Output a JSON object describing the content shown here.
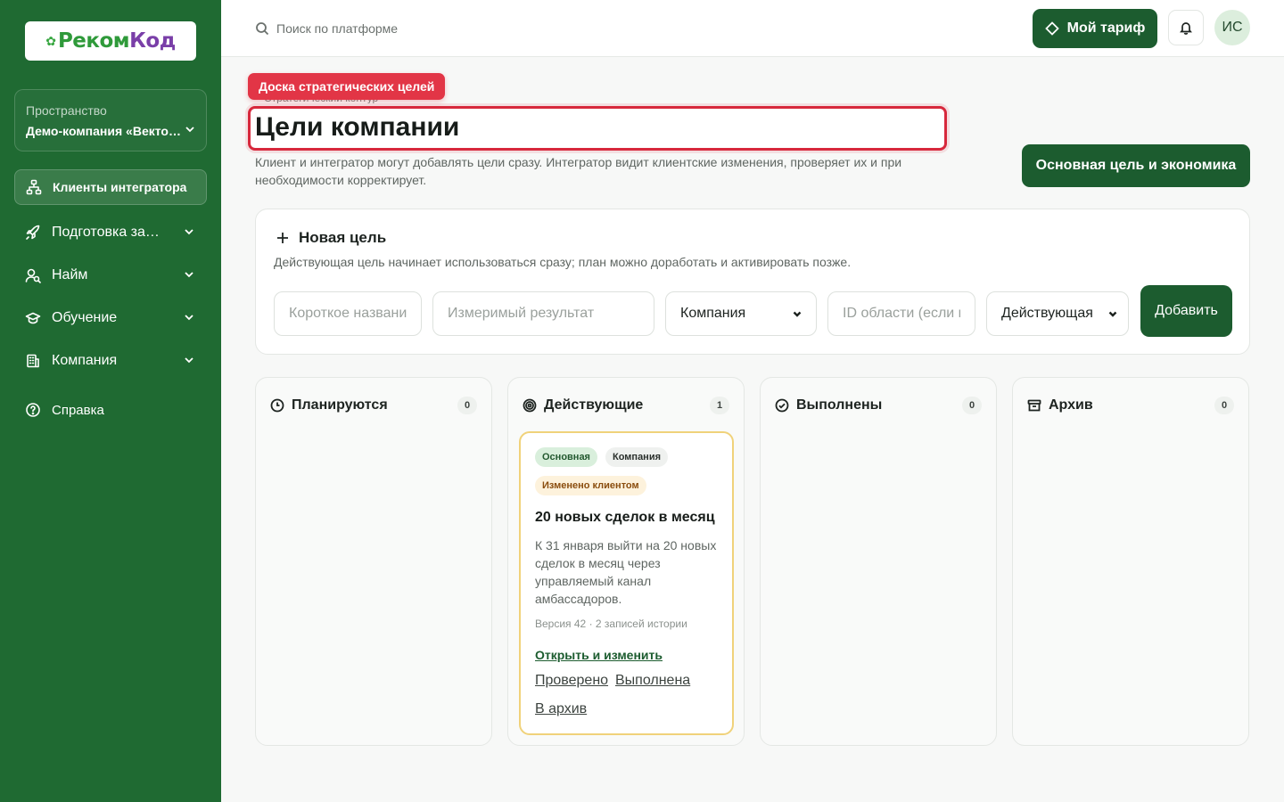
{
  "sidebar": {
    "logo": {
      "part1": "Реком",
      "part2": "Код"
    },
    "space": {
      "label": "Пространство",
      "name": "Демо-компания «Вектор»"
    },
    "items": [
      {
        "label": "Клиенты интегратора",
        "icon": "network-icon",
        "active": true
      },
      {
        "label": "Подготовка запуска",
        "icon": "rocket-icon"
      },
      {
        "label": "Найм",
        "icon": "user-search-icon"
      },
      {
        "label": "Обучение",
        "icon": "graduation-cap-icon"
      },
      {
        "label": "Компания",
        "icon": "building-icon"
      },
      {
        "label": "Справка",
        "icon": "help-circle-icon"
      }
    ]
  },
  "topbar": {
    "search_placeholder": "Поиск по платформе",
    "plan_label": "Мой тариф",
    "avatar_initials": "ИС"
  },
  "header": {
    "tag": "Доска стратегических целей",
    "crumb": "Стратегический контур",
    "title": "Цели компании",
    "description": "Клиент и интегратор могут добавлять цели сразу. Интегратор видит клиентские изменения, проверяет их и при необходимости корректирует.",
    "main_goal_button": "Основная цель и экономика"
  },
  "new_goal": {
    "title": "Новая цель",
    "description": "Действующая цель начинает использоваться сразу; план можно доработать и активировать позже.",
    "name_placeholder": "Короткое название",
    "result_placeholder": "Измеримый результат",
    "scope_value": "Компания",
    "area_placeholder": "ID области (если нужно)",
    "status_value": "Действующая",
    "add_label": "Добавить"
  },
  "columns": [
    {
      "title": "Планируются",
      "count": "0",
      "icon": "clock-icon"
    },
    {
      "title": "Действующие",
      "count": "1",
      "icon": "target-icon"
    },
    {
      "title": "Выполнены",
      "count": "0",
      "icon": "check-circle-icon"
    },
    {
      "title": "Архив",
      "count": "0",
      "icon": "archive-icon"
    }
  ],
  "goal_card": {
    "badge_main": "Основная",
    "badge_scope": "Компания",
    "badge_changed": "Изменено клиентом",
    "title": "20 новых сделок в месяц",
    "description": "К 31 января выйти на 20 новых сделок в месяц через управляемый канал амбассадоров.",
    "meta": "Версия 42 · 2 записей истории",
    "open_link": "Открыть и изменить",
    "action_checked": "Проверено",
    "action_done": "Выполнена",
    "action_archive": "В архив"
  },
  "colors": {
    "sidebar": "#1f6a32",
    "primary": "#1c5c2f",
    "highlight": "#d7283c",
    "card_border": "#f0d27a"
  }
}
